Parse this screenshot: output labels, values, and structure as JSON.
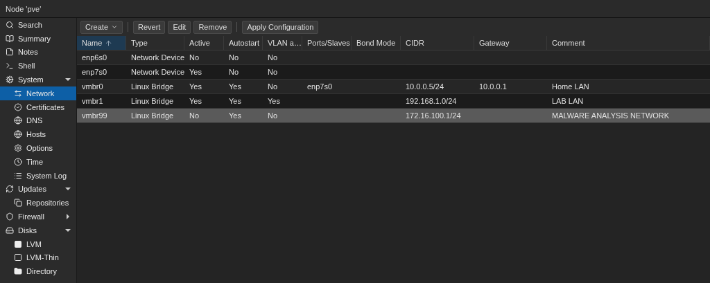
{
  "title": "Node 'pve'",
  "sidebar": [
    {
      "label": "Search",
      "kind": "search",
      "selected": false
    },
    {
      "label": "Summary",
      "kind": "book",
      "selected": false
    },
    {
      "label": "Notes",
      "kind": "note",
      "selected": false
    },
    {
      "label": "Shell",
      "kind": "terminal",
      "selected": false
    },
    {
      "label": "System",
      "kind": "cogs",
      "selected": false,
      "expanded": true,
      "children": [
        {
          "label": "Network",
          "kind": "arrows",
          "selected": true
        },
        {
          "label": "Certificates",
          "kind": "cert",
          "selected": false
        },
        {
          "label": "DNS",
          "kind": "globe",
          "selected": false
        },
        {
          "label": "Hosts",
          "kind": "globe",
          "selected": false
        },
        {
          "label": "Options",
          "kind": "gear",
          "selected": false
        },
        {
          "label": "Time",
          "kind": "clock",
          "selected": false
        },
        {
          "label": "System Log",
          "kind": "list",
          "selected": false
        }
      ]
    },
    {
      "label": "Updates",
      "kind": "refresh",
      "selected": false,
      "expanded": true,
      "children": [
        {
          "label": "Repositories",
          "kind": "copy",
          "selected": false
        }
      ]
    },
    {
      "label": "Firewall",
      "kind": "shield",
      "selected": false,
      "expanded": false
    },
    {
      "label": "Disks",
      "kind": "drive",
      "selected": false,
      "expanded": true,
      "children": [
        {
          "label": "LVM",
          "kind": "square-filled",
          "selected": false
        },
        {
          "label": "LVM-Thin",
          "kind": "square",
          "selected": false
        },
        {
          "label": "Directory",
          "kind": "folder",
          "selected": false
        }
      ]
    }
  ],
  "toolbar": [
    {
      "label": "Create",
      "kind": "menu"
    },
    {
      "kind": "separator"
    },
    {
      "label": "Revert",
      "kind": "button"
    },
    {
      "label": "Edit",
      "kind": "button"
    },
    {
      "label": "Remove",
      "kind": "button"
    },
    {
      "kind": "separator"
    },
    {
      "label": "Apply Configuration",
      "kind": "button"
    }
  ],
  "table": {
    "columns": [
      {
        "label": "Name",
        "sorted": true
      },
      {
        "label": "Type",
        "sorted": false
      },
      {
        "label": "Active",
        "sorted": false
      },
      {
        "label": "Autostart",
        "sorted": false
      },
      {
        "label": "VLAN a…",
        "sorted": false
      },
      {
        "label": "Ports/Slaves",
        "sorted": false
      },
      {
        "label": "Bond Mode",
        "sorted": false
      },
      {
        "label": "CIDR",
        "sorted": false
      },
      {
        "label": "Gateway",
        "sorted": false
      },
      {
        "label": "Comment",
        "sorted": false
      }
    ],
    "rows": [
      {
        "selected": false,
        "cells": [
          "enp6s0",
          "Network Device",
          "No",
          "No",
          "No",
          "",
          "",
          "",
          "",
          ""
        ]
      },
      {
        "selected": false,
        "cells": [
          "enp7s0",
          "Network Device",
          "Yes",
          "No",
          "No",
          "",
          "",
          "",
          "",
          ""
        ]
      },
      {
        "selected": false,
        "cells": [
          "vmbr0",
          "Linux Bridge",
          "Yes",
          "Yes",
          "No",
          "enp7s0",
          "",
          "10.0.0.5/24",
          "10.0.0.1",
          "Home LAN"
        ]
      },
      {
        "selected": false,
        "cells": [
          "vmbr1",
          "Linux Bridge",
          "Yes",
          "Yes",
          "Yes",
          "",
          "",
          "192.168.1.0/24",
          "",
          "LAB LAN"
        ]
      },
      {
        "selected": true,
        "cells": [
          "vmbr99",
          "Linux Bridge",
          "No",
          "Yes",
          "No",
          "",
          "",
          "172.16.100.1/24",
          "",
          "MALWARE ANALYSIS NETWORK"
        ]
      }
    ]
  }
}
